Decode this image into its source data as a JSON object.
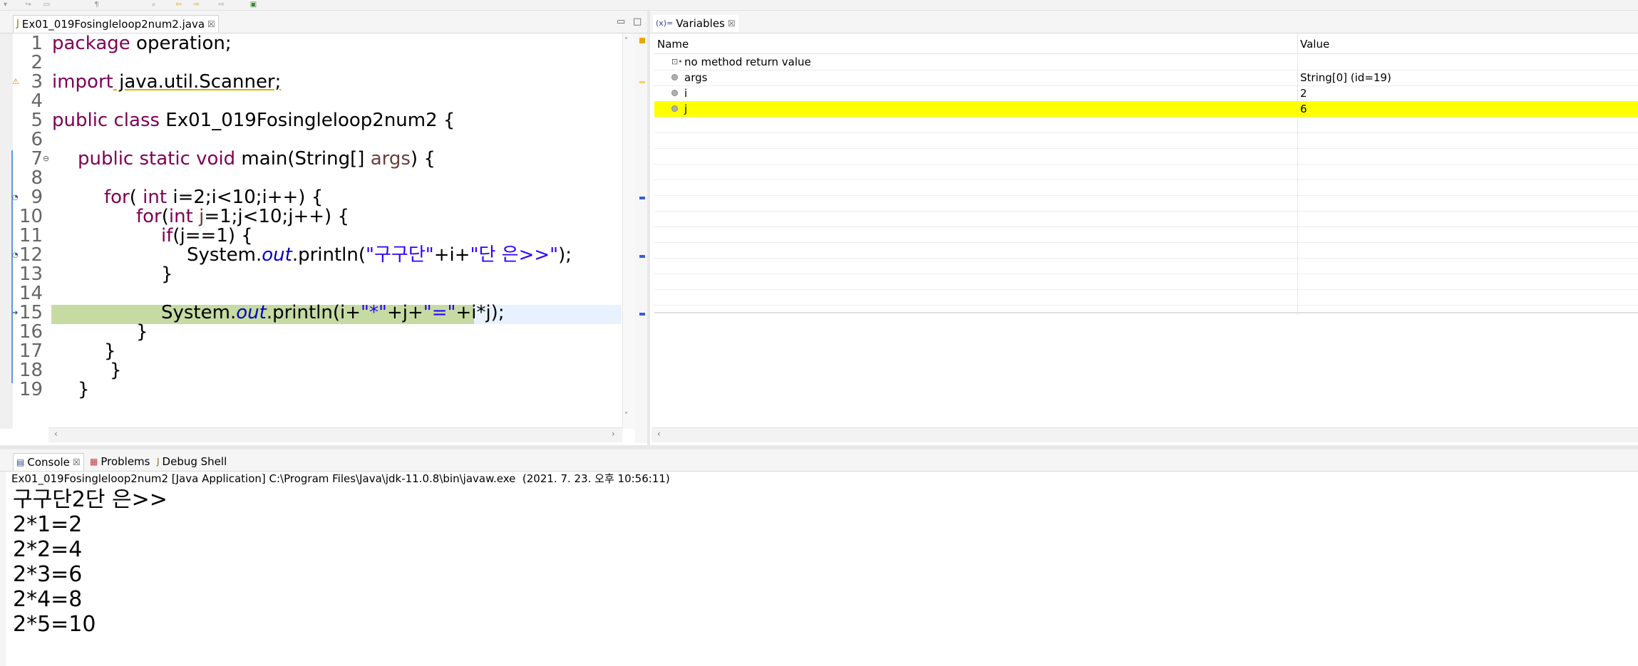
{
  "editor": {
    "tab_label": "Ex01_019Fosingleloop2num2.java",
    "tab_close": "☒",
    "lines": [
      {
        "n": "1"
      },
      {
        "n": "2"
      },
      {
        "n": "3"
      },
      {
        "n": "4"
      },
      {
        "n": "5"
      },
      {
        "n": "6"
      },
      {
        "n": "7"
      },
      {
        "n": "8"
      },
      {
        "n": "9"
      },
      {
        "n": "10"
      },
      {
        "n": "11"
      },
      {
        "n": "12"
      },
      {
        "n": "13"
      },
      {
        "n": "14"
      },
      {
        "n": "15"
      },
      {
        "n": "16"
      },
      {
        "n": "17"
      },
      {
        "n": "18"
      },
      {
        "n": "19"
      }
    ],
    "code": {
      "l1_kw": "package",
      "l1_rest": " operation;",
      "l3_kw": "import",
      "l3_rest": " java.util.Scanner;",
      "l5_kw": "public class",
      "l5_rest": " Ex01_019Fosingleloop2num2 {",
      "l7_kw": "public static void",
      "l7_rest": " main(String[] ",
      "l7_var": "args",
      "l7_end": ") {",
      "l9_kw": "for",
      "l9_a": "( ",
      "l9_kw2": "int",
      "l9_rest": " i=2;i<10;i++) {",
      "l10_kw": "for",
      "l10_a": "(",
      "l10_kw2": "int",
      "l10_b": " ",
      "l10_var": "j",
      "l10_rest": "=1;j<10;j++) {",
      "l11_kw": "if",
      "l11_rest": "(j==1) {",
      "l12_a": "System.",
      "l12_field": "out",
      "l12_b": ".println(",
      "l12_s1": "\"구구단\"",
      "l12_c": "+i+",
      "l12_s2": "\"단 은>>\"",
      "l12_d": ");",
      "l13": "}",
      "l15_a": "System.",
      "l15_field": "out",
      "l15_b": ".println(i+",
      "l15_s1": "\"*\"",
      "l15_c": "+j+",
      "l15_s2": "\"=\"",
      "l15_d": "+i*j);",
      "l16": "}",
      "l17": "}",
      "l18": "}",
      "l19": "}"
    }
  },
  "variables": {
    "tab_label": "Variables",
    "tab_icon": "(x)=",
    "tab_close": "☒",
    "col_name": "Name",
    "col_value": "Value",
    "rows": [
      {
        "name": "no method return value",
        "value": ""
      },
      {
        "name": "args",
        "value": "String[0]  (id=19)"
      },
      {
        "name": "i",
        "value": "2"
      },
      {
        "name": "j",
        "value": "6"
      }
    ],
    "highlight_color": "#ffff00"
  },
  "console": {
    "tabs": [
      {
        "label": "Console",
        "close": "☒"
      },
      {
        "label": "Problems"
      },
      {
        "label": "Debug Shell"
      }
    ],
    "description": "Ex01_019Fosingleloop2num2 [Java Application] C:\\Program Files\\Java\\jdk-11.0.8\\bin\\javaw.exe  (2021. 7. 23. 오후 10:56:11)",
    "output": [
      "구구단2단 은>>",
      "2*1=2",
      "2*2=4",
      "2*3=6",
      "2*4=8",
      "2*5=10"
    ]
  }
}
